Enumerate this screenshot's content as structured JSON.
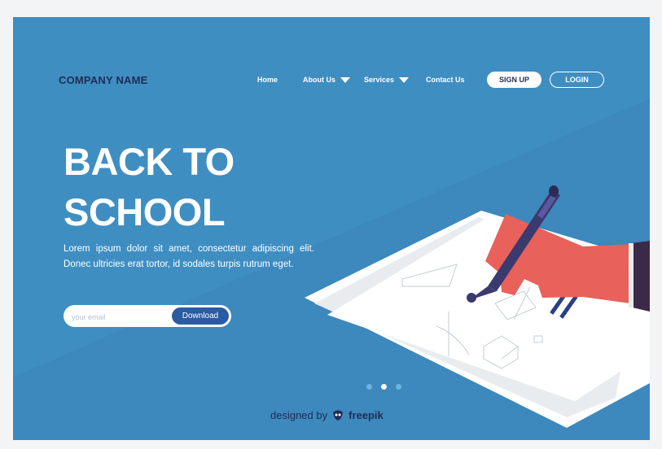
{
  "brand": {
    "name": "COMPANY NAME"
  },
  "nav": {
    "items": [
      {
        "label": "Home",
        "dropdown": false
      },
      {
        "label": "About Us",
        "dropdown": true
      },
      {
        "label": "Services",
        "dropdown": true
      },
      {
        "label": "Contact Us",
        "dropdown": false
      }
    ],
    "signup_label": "SIGN UP",
    "login_label": "LOGIN"
  },
  "hero": {
    "title_line1": "BACK TO",
    "title_line2": "SCHOOL",
    "description": "Lorem ipsum dolor sit amet, consectetur adipiscing elit. Donec ultricies erat tortor, id sodales turpis rutrum eget.",
    "email_placeholder": "your email",
    "download_label": "Download"
  },
  "carousel": {
    "count": 3,
    "active": 2
  },
  "footer": {
    "designed_by": "designed by",
    "brand": "freepik"
  },
  "icons": [
    "chevron-down-icon",
    "freepik-logo-icon"
  ],
  "colors": {
    "background": "#3f8ec2",
    "brand_text": "#1f2d54",
    "button": "#2a5ba3",
    "hand": "#e8615a",
    "pen": "#3b3a6e",
    "sleeve": "#3a2948"
  }
}
